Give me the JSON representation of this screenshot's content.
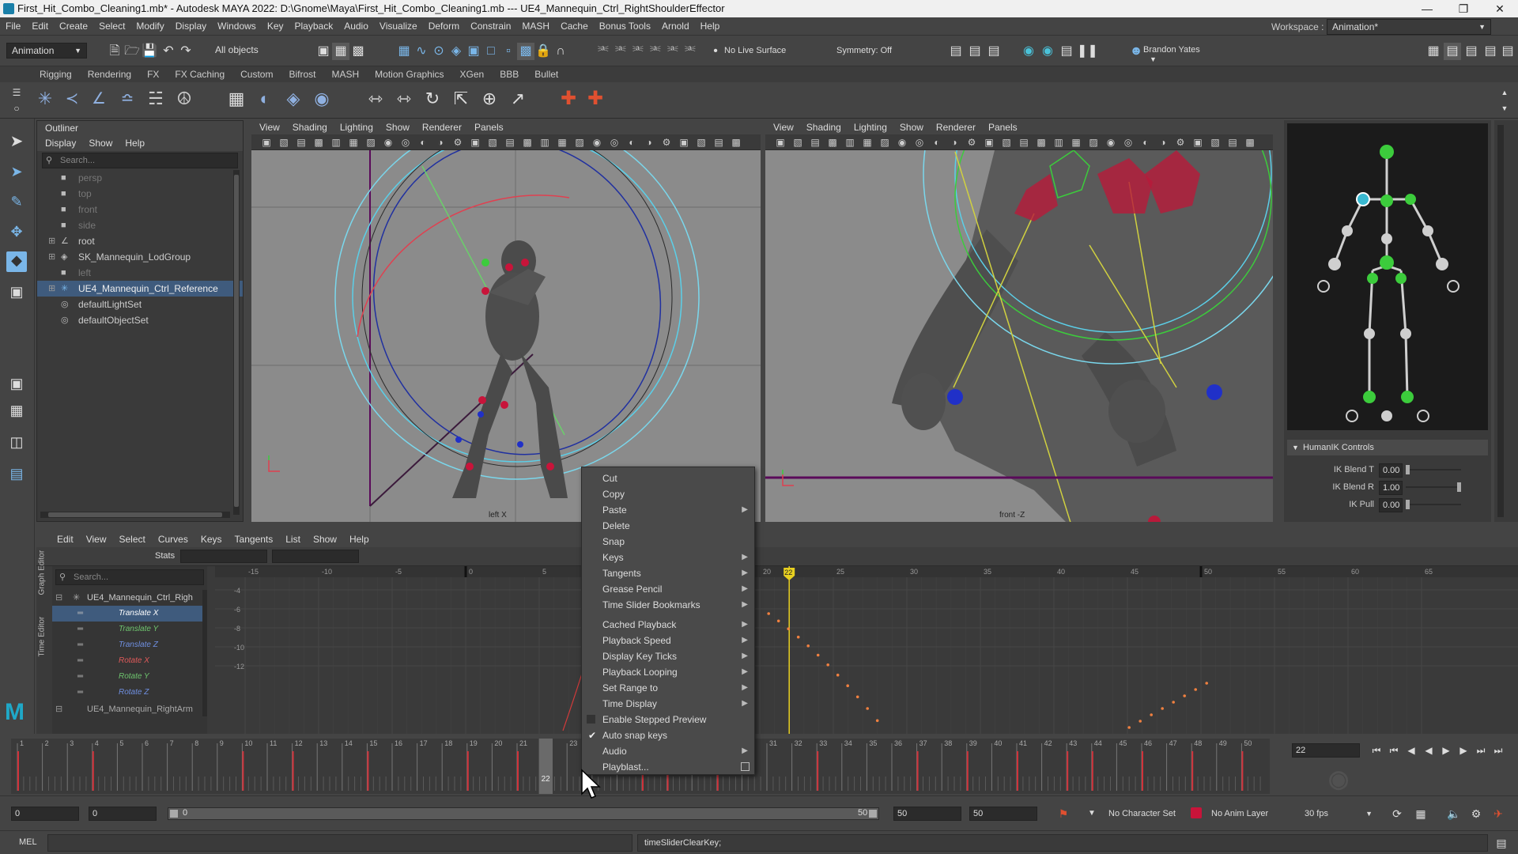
{
  "window": {
    "title": "First_Hit_Combo_Cleaning1.mb* - Autodesk MAYA 2022: D:\\Gnome\\Maya\\First_Hit_Combo_Cleaning1.mb --- UE4_Mannequin_Ctrl_RightShoulderEffector",
    "workspace_label": "Workspace :",
    "workspace_value": "Animation*"
  },
  "menubar": [
    "File",
    "Edit",
    "Create",
    "Select",
    "Modify",
    "Display",
    "Windows",
    "Key",
    "Playback",
    "Audio",
    "Visualize",
    "Deform",
    "Constrain",
    "MASH",
    "Cache",
    "Bonus Tools",
    "Arnold",
    "Help"
  ],
  "statusline": {
    "mode": "Animation",
    "objects": "All objects",
    "live_surface": "No Live Surface",
    "symmetry": "Symmetry: Off",
    "user": "Brandon Yates"
  },
  "shelf_tabs": [
    "Rigging",
    "Rendering",
    "FX",
    "FX Caching",
    "Custom",
    "Bifrost",
    "MASH",
    "Motion Graphics",
    "XGen",
    "BBB",
    "Bullet"
  ],
  "outliner": {
    "title": "Outliner",
    "menu": [
      "Display",
      "Show",
      "Help"
    ],
    "search_placeholder": "Search...",
    "items": [
      {
        "label": "persp",
        "dim": true
      },
      {
        "label": "top",
        "dim": true
      },
      {
        "label": "front",
        "dim": true
      },
      {
        "label": "side",
        "dim": true
      },
      {
        "label": "root",
        "dim": false
      },
      {
        "label": "SK_Mannequin_LodGroup",
        "dim": false
      },
      {
        "label": "left",
        "dim": true
      },
      {
        "label": "UE4_Mannequin_Ctrl_Reference",
        "dim": false
      },
      {
        "label": "defaultLightSet",
        "dim": false
      },
      {
        "label": "defaultObjectSet",
        "dim": false
      }
    ]
  },
  "viewport_left": {
    "menu": [
      "View",
      "Shading",
      "Lighting",
      "Show",
      "Renderer",
      "Panels"
    ],
    "camera_label": "left X"
  },
  "viewport_right": {
    "menu": [
      "View",
      "Shading",
      "Lighting",
      "Show",
      "Renderer",
      "Panels"
    ],
    "camera_label": "front -Z"
  },
  "humanik": {
    "section": "HumanIK Controls",
    "rows": [
      {
        "label": "IK Blend T",
        "value": "0.00"
      },
      {
        "label": "IK Blend R",
        "value": "1.00"
      },
      {
        "label": "IK Pull",
        "value": "0.00"
      }
    ]
  },
  "graph_editor": {
    "menu": [
      "Edit",
      "View",
      "Select",
      "Curves",
      "Keys",
      "Tangents",
      "List",
      "Show",
      "Help"
    ],
    "stats_label": "Stats",
    "search_placeholder": "Search...",
    "tree_root": "UE4_Mannequin_Ctrl_Righ",
    "tree_next": "UE4_Mannequin_RightArm",
    "channels": [
      {
        "label": "Translate X",
        "color": "#e05a5a"
      },
      {
        "label": "Translate Y",
        "color": "#6ec46e"
      },
      {
        "label": "Translate Z",
        "color": "#6f8fe0"
      },
      {
        "label": "Rotate X",
        "color": "#e05a5a"
      },
      {
        "label": "Rotate Y",
        "color": "#6ec46e"
      },
      {
        "label": "Rotate Z",
        "color": "#6f8fe0"
      }
    ],
    "ruler_left": [
      "-15",
      "-10",
      "-5",
      "0",
      "5"
    ],
    "ruler_right": [
      "20",
      "25",
      "30",
      "35",
      "40",
      "45",
      "50",
      "55",
      "60",
      "65"
    ],
    "value_ticks": [
      "-4",
      "-6",
      "-8",
      "-10",
      "-12"
    ],
    "current_frame_marker": "22",
    "side_tabs": [
      "Graph Editor",
      "Time Editor"
    ]
  },
  "time_slider": {
    "frame_ticks": [
      "1",
      "2",
      "3",
      "4",
      "5",
      "6",
      "7",
      "8",
      "9",
      "10",
      "11",
      "12",
      "13",
      "14",
      "15",
      "16",
      "17",
      "18",
      "19",
      "20",
      "21",
      "22",
      "23",
      "24",
      "25",
      "26",
      "27",
      "28",
      "29",
      "30",
      "31",
      "32",
      "33",
      "34",
      "35",
      "36",
      "37",
      "38",
      "39",
      "40",
      "41",
      "42",
      "43",
      "44",
      "45",
      "46",
      "47",
      "48",
      "49",
      "50"
    ],
    "current_frame": "22",
    "current_frame_field": "22"
  },
  "range_slider": {
    "start": "0",
    "anim_start": "0",
    "range_start": "0",
    "range_end": "50",
    "anim_end": "50",
    "end": "50",
    "character_set": "No Character Set",
    "anim_layer": "No Anim Layer",
    "fps": "30 fps"
  },
  "command_line": {
    "mode": "MEL",
    "feedback": "timeSliderClearKey;"
  },
  "context_menu": {
    "items": [
      {
        "label": "Cut",
        "submenu": false,
        "checked": false
      },
      {
        "label": "Copy",
        "submenu": false,
        "checked": false
      },
      {
        "label": "Paste",
        "submenu": true,
        "checked": false
      },
      {
        "label": "Delete",
        "submenu": false,
        "checked": false
      },
      {
        "label": "Snap",
        "submenu": false,
        "checked": false
      },
      {
        "label": "Keys",
        "submenu": true,
        "checked": false
      },
      {
        "label": "Tangents",
        "submenu": true,
        "checked": false
      },
      {
        "label": "Grease Pencil",
        "submenu": true,
        "checked": false
      },
      {
        "label": "Time Slider Bookmarks",
        "submenu": true,
        "checked": false
      },
      {
        "label": "Cached Playback",
        "submenu": true,
        "checked": false
      },
      {
        "label": "Playback Speed",
        "submenu": true,
        "checked": false
      },
      {
        "label": "Display Key Ticks",
        "submenu": true,
        "checked": false
      },
      {
        "label": "Playback Looping",
        "submenu": true,
        "checked": false
      },
      {
        "label": "Set Range to",
        "submenu": true,
        "checked": false
      },
      {
        "label": "Time Display",
        "submenu": true,
        "checked": false
      },
      {
        "label": "Enable Stepped Preview",
        "submenu": false,
        "checked": false
      },
      {
        "label": "Auto snap keys",
        "submenu": false,
        "checked": true
      },
      {
        "label": "Audio",
        "submenu": true,
        "checked": false
      },
      {
        "label": "Playblast...",
        "submenu": false,
        "checked": false
      }
    ]
  },
  "colors": {
    "selection": "#3f5b7d",
    "key_tick": "#d0323a",
    "current_frame": "#e8d020",
    "viewport_bg": "#8b8b8b"
  }
}
